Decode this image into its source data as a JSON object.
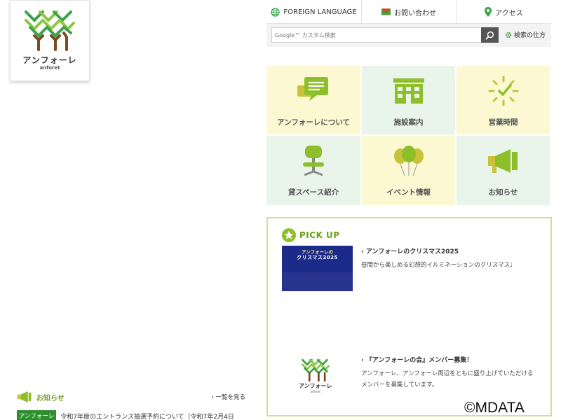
{
  "logo": {
    "name": "アンフォーレ",
    "sub": "anforet"
  },
  "topbar": {
    "language": "FOREIGN LANGUAGE",
    "contact": "お問い合わせ",
    "access": "アクセス"
  },
  "search": {
    "placeholder": "Google™ カスタム検索",
    "help": "検索の仕方"
  },
  "menu": [
    {
      "label": "アンフォーレについて",
      "icon": "speech-bubble-icon",
      "bg": "yellow"
    },
    {
      "label": "施設案内",
      "icon": "building-icon",
      "bg": "green"
    },
    {
      "label": "営業時間",
      "icon": "clock-icon",
      "bg": "yellow"
    },
    {
      "label": "貸スペース紹介",
      "icon": "chair-icon",
      "bg": "green"
    },
    {
      "label": "イベント情報",
      "icon": "balloon-icon",
      "bg": "yellow"
    },
    {
      "label": "お知らせ",
      "icon": "megaphone-icon",
      "bg": "green"
    }
  ],
  "pickup": {
    "title": "PICK UP",
    "items": [
      {
        "title": "アンフォーレのクリスマス2025",
        "desc": "昼間から楽しめる幻想的イルミネーションのクリスマス♩",
        "thumb_line1": "アンフォーレの",
        "thumb_line2": "クリスマス2025"
      },
      {
        "title": "『アンフォーレの会』メンバー募集！",
        "desc": "アンフォーレ、アンフォーレ周辺をともに盛り上げていただけるメンバーを募集しています。",
        "thumb_name": "アンフォーレ",
        "thumb_sub": "anforet"
      }
    ]
  },
  "news": {
    "title": "お知らせ",
    "more": "一覧を見る",
    "items": [
      {
        "category": "アンフォーレ",
        "text": "令和7年度のエントランス抽選予約について（令和7年2月4日"
      }
    ]
  },
  "copyright": "©MDATA",
  "colors": {
    "accent_green": "#6a9f12",
    "tile_yellow": "#fbf8d2",
    "tile_green": "#e9f5ea",
    "pickup_border": "#cfe28d"
  }
}
